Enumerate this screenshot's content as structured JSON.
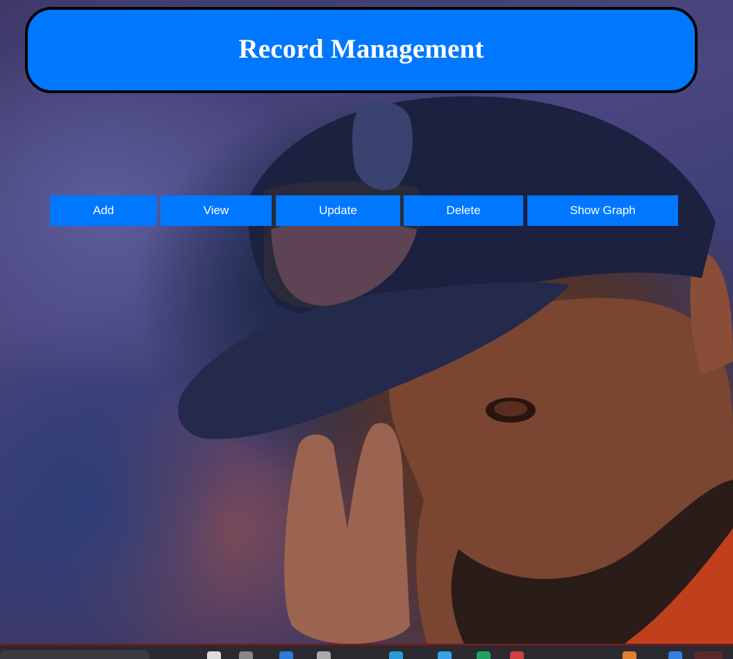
{
  "header": {
    "title": "Record Management",
    "background_color": "#0077ff",
    "border_color": "#000000"
  },
  "nav": {
    "buttons": [
      {
        "id": "add",
        "label": "Add"
      },
      {
        "id": "view",
        "label": "View"
      },
      {
        "id": "update",
        "label": "Update"
      },
      {
        "id": "delete",
        "label": "Delete"
      },
      {
        "id": "show-graph",
        "label": "Show Graph"
      }
    ],
    "button_color": "#0077ff",
    "text_color": "#ffffff"
  },
  "background": {
    "description_icon": "photo-background"
  },
  "taskbar": {
    "icons": [
      "search-box",
      "file-explorer-icon",
      "browser-icon",
      "store-icon",
      "app-icon",
      "chrome-icon",
      "edge-icon",
      "mail-icon",
      "notes-icon",
      "folder-icon",
      "system-tray-icon"
    ]
  }
}
